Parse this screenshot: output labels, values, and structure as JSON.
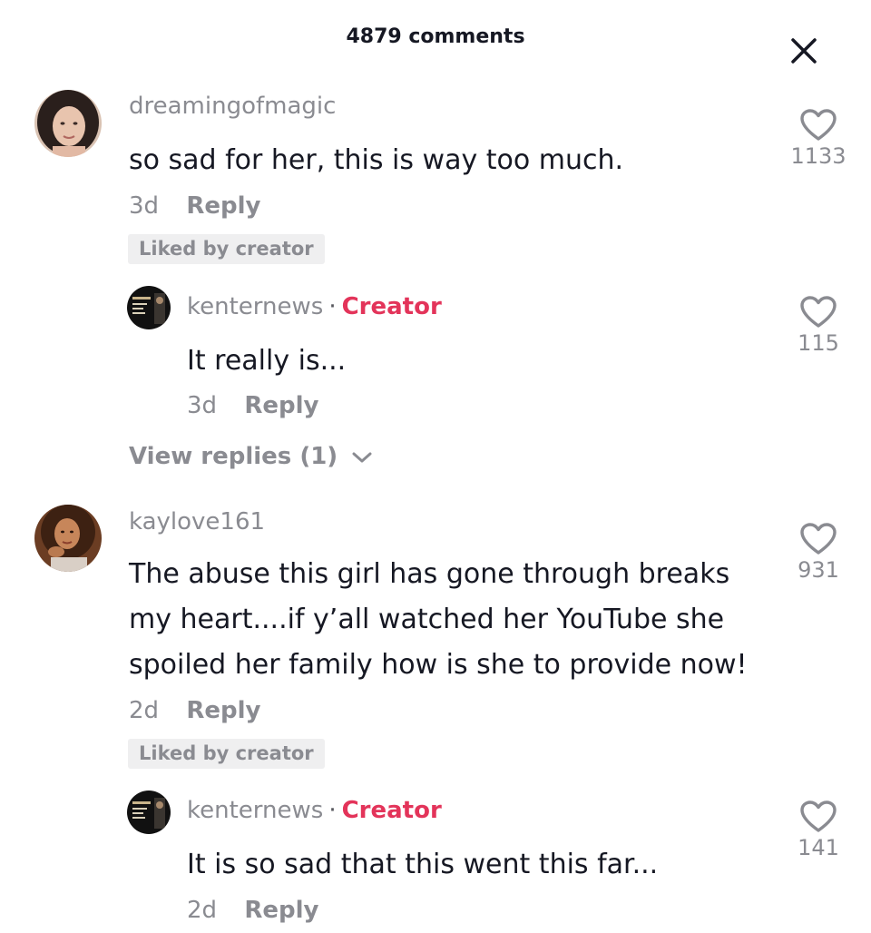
{
  "header": {
    "title": "4879 comments",
    "close_icon": "close-icon"
  },
  "comments": [
    {
      "username": "dreamingofmagic",
      "text": "so sad for her, this is way too much.",
      "age": "3d",
      "reply_label": "Reply",
      "like_count": "1133",
      "liked_badge": "Liked by creator",
      "reply": {
        "username": "kenternews",
        "separator": "·",
        "creator_tag": "Creator",
        "text": "It really is...",
        "age": "3d",
        "reply_label": "Reply",
        "like_count": "115"
      },
      "view_replies": "View replies (1)"
    },
    {
      "username": "kaylove161",
      "text_lines": [
        "The abuse this girl has gone through breaks",
        "my heart....if y’all watched her YouTube she",
        "spoiled her family how is she to provide now!"
      ],
      "age": "2d",
      "reply_label": "Reply",
      "like_count": "931",
      "liked_badge": "Liked by creator",
      "reply": {
        "username": "kenternews",
        "separator": "·",
        "creator_tag": "Creator",
        "text": "It is so sad that this went this far...",
        "age": "2d",
        "reply_label": "Reply",
        "like_count": "141"
      }
    }
  ],
  "colors": {
    "accent_creator": "#e3345a",
    "text_primary": "#161823",
    "text_secondary": "#8a8b91",
    "badge_bg": "#efeff0"
  }
}
